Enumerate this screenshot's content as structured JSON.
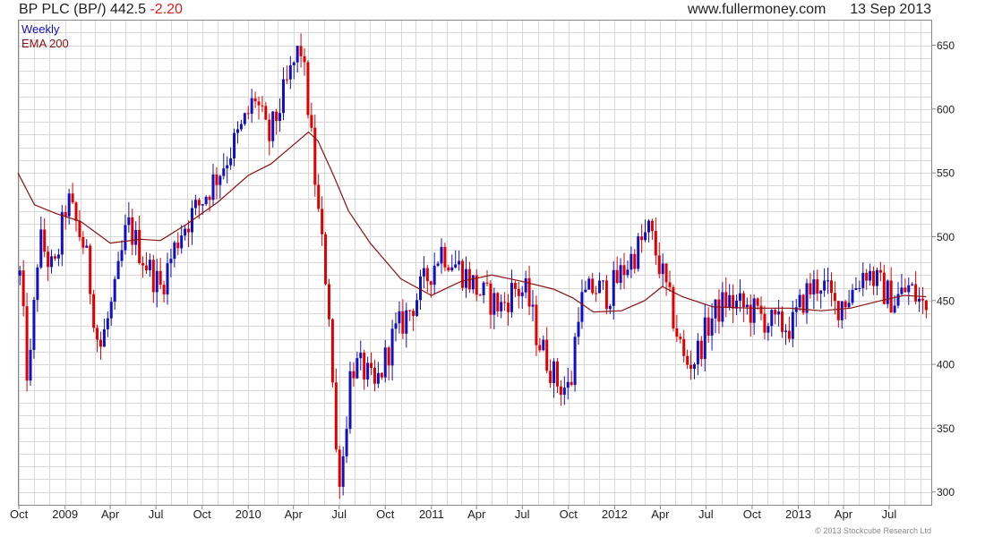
{
  "header": {
    "symbol": "BP PLC (BP/)",
    "price": "442.5",
    "change": "-2.20",
    "source": "www.fullermoney.com",
    "date": "13 Sep 2013"
  },
  "copyright": "© 2013 Stockcube Research Ltd",
  "colors": {
    "up": "#1010c0",
    "down": "#e00000",
    "ema": "#8b1010",
    "grid": "#d8d8d8"
  },
  "chart_data": {
    "type": "candlestick",
    "legend": [
      "Weekly",
      "EMA 200"
    ],
    "x_ticks": [
      "Oct",
      "2009",
      "Apr",
      "Jul",
      "Oct",
      "2010",
      "Apr",
      "Jul",
      "Oct",
      "2011",
      "Apr",
      "Jul",
      "Oct",
      "2012",
      "Apr",
      "Jul",
      "Oct",
      "2013",
      "Apr",
      "Jul"
    ],
    "y_ticks": [
      300,
      350,
      400,
      450,
      500,
      550,
      600,
      650
    ],
    "ylim": [
      290,
      670
    ],
    "x_range": [
      "2008-09-29",
      "2013-09-23"
    ],
    "price_path": [
      [
        "2008-10-01",
        480
      ],
      [
        "2008-10-20",
        380
      ],
      [
        "2008-11-10",
        500
      ],
      [
        "2008-12-10",
        470
      ],
      [
        "2009-01-05",
        530
      ],
      [
        "2009-02-10",
        490
      ],
      [
        "2009-03-10",
        410
      ],
      [
        "2009-04-10",
        455
      ],
      [
        "2009-05-05",
        510
      ],
      [
        "2009-06-10",
        480
      ],
      [
        "2009-07-10",
        460
      ],
      [
        "2009-08-20",
        505
      ],
      [
        "2009-09-25",
        525
      ],
      [
        "2009-11-10",
        555
      ],
      [
        "2009-12-20",
        585
      ],
      [
        "2010-01-15",
        610
      ],
      [
        "2010-02-10",
        575
      ],
      [
        "2010-03-20",
        620
      ],
      [
        "2010-04-15",
        650
      ],
      [
        "2010-05-01",
        600
      ],
      [
        "2010-05-20",
        520
      ],
      [
        "2010-06-10",
        450
      ],
      [
        "2010-06-25",
        330
      ],
      [
        "2010-07-05",
        310
      ],
      [
        "2010-07-25",
        400
      ],
      [
        "2010-08-20",
        395
      ],
      [
        "2010-09-10",
        380
      ],
      [
        "2010-10-15",
        420
      ],
      [
        "2010-11-15",
        440
      ],
      [
        "2010-12-20",
        465
      ],
      [
        "2011-01-20",
        490
      ],
      [
        "2011-02-15",
        480
      ],
      [
        "2011-03-10",
        470
      ],
      [
        "2011-04-10",
        455
      ],
      [
        "2011-05-20",
        445
      ],
      [
        "2011-06-15",
        460
      ],
      [
        "2011-07-10",
        455
      ],
      [
        "2011-08-01",
        420
      ],
      [
        "2011-09-10",
        385
      ],
      [
        "2011-10-05",
        380
      ],
      [
        "2011-10-20",
        445
      ],
      [
        "2011-11-20",
        460
      ],
      [
        "2011-12-20",
        455
      ],
      [
        "2012-01-20",
        475
      ],
      [
        "2012-02-15",
        490
      ],
      [
        "2012-03-10",
        505
      ],
      [
        "2012-04-05",
        470
      ],
      [
        "2012-04-25",
        440
      ],
      [
        "2012-05-20",
        400
      ],
      [
        "2012-06-10",
        405
      ],
      [
        "2012-07-10",
        435
      ],
      [
        "2012-08-10",
        450
      ],
      [
        "2012-09-10",
        445
      ],
      [
        "2012-10-10",
        440
      ],
      [
        "2012-11-15",
        430
      ],
      [
        "2012-12-20",
        430
      ],
      [
        "2013-01-15",
        455
      ],
      [
        "2013-02-15",
        465
      ],
      [
        "2013-03-15",
        445
      ],
      [
        "2013-04-15",
        455
      ],
      [
        "2013-05-15",
        475
      ],
      [
        "2013-06-15",
        460
      ],
      [
        "2013-07-10",
        450
      ],
      [
        "2013-08-10",
        460
      ],
      [
        "2013-09-13",
        442.5
      ]
    ],
    "ema_200": [
      [
        "2008-09-29",
        550
      ],
      [
        "2008-11-01",
        525
      ],
      [
        "2008-12-15",
        518
      ],
      [
        "2009-02-01",
        512
      ],
      [
        "2009-04-01",
        495
      ],
      [
        "2009-06-01",
        498
      ],
      [
        "2009-07-10",
        497
      ],
      [
        "2009-09-01",
        510
      ],
      [
        "2009-11-01",
        527
      ],
      [
        "2010-01-01",
        548
      ],
      [
        "2010-02-15",
        557
      ],
      [
        "2010-04-01",
        572
      ],
      [
        "2010-05-01",
        582
      ],
      [
        "2010-05-20",
        575
      ],
      [
        "2010-06-20",
        548
      ],
      [
        "2010-07-20",
        520
      ],
      [
        "2010-09-01",
        495
      ],
      [
        "2010-11-01",
        467
      ],
      [
        "2011-01-01",
        454
      ],
      [
        "2011-03-01",
        465
      ],
      [
        "2011-05-01",
        470
      ],
      [
        "2011-07-01",
        465
      ],
      [
        "2011-09-01",
        459
      ],
      [
        "2011-10-10",
        452
      ],
      [
        "2011-11-20",
        441
      ],
      [
        "2012-01-15",
        442
      ],
      [
        "2012-03-01",
        450
      ],
      [
        "2012-04-05",
        461
      ],
      [
        "2012-05-15",
        453
      ],
      [
        "2012-07-15",
        445
      ],
      [
        "2012-10-01",
        444
      ],
      [
        "2012-12-15",
        444
      ],
      [
        "2013-02-15",
        442
      ],
      [
        "2013-04-15",
        444
      ],
      [
        "2013-06-15",
        450
      ],
      [
        "2013-08-01",
        454
      ],
      [
        "2013-09-13",
        453
      ]
    ]
  }
}
